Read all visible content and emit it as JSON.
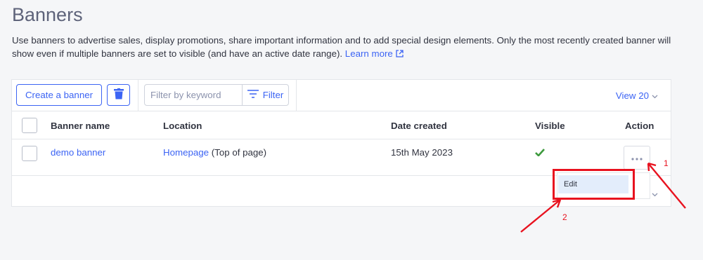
{
  "page": {
    "title": "Banners",
    "description": "Use banners to advertise sales, display promotions, share important information and to add special design elements. Only the most recently created banner will show even if multiple banners are set to visible (and have an active date range).",
    "learn_more": "Learn more"
  },
  "toolbar": {
    "create_label": "Create a banner",
    "search_placeholder": "Filter by keyword",
    "filter_label": "Filter",
    "view_label": "View 20"
  },
  "table": {
    "headers": {
      "name": "Banner name",
      "location": "Location",
      "date": "Date created",
      "visible": "Visible",
      "action": "Action"
    },
    "rows": [
      {
        "name": "demo banner",
        "location_link": "Homepage",
        "location_suffix": " (Top of page)",
        "date": "15th May 2023",
        "visible": true
      }
    ]
  },
  "action_menu": {
    "items": [
      "Edit"
    ]
  },
  "annotations": {
    "callout_1": "1",
    "callout_2": "2"
  },
  "colors": {
    "accent": "#3c64f4",
    "check": "#3d9a3d",
    "annotation": "#e8121f"
  },
  "icons": [
    "trash-icon",
    "filter-icon",
    "chevron-down-icon",
    "external-link-icon",
    "check-icon",
    "more-horizontal-icon"
  ]
}
